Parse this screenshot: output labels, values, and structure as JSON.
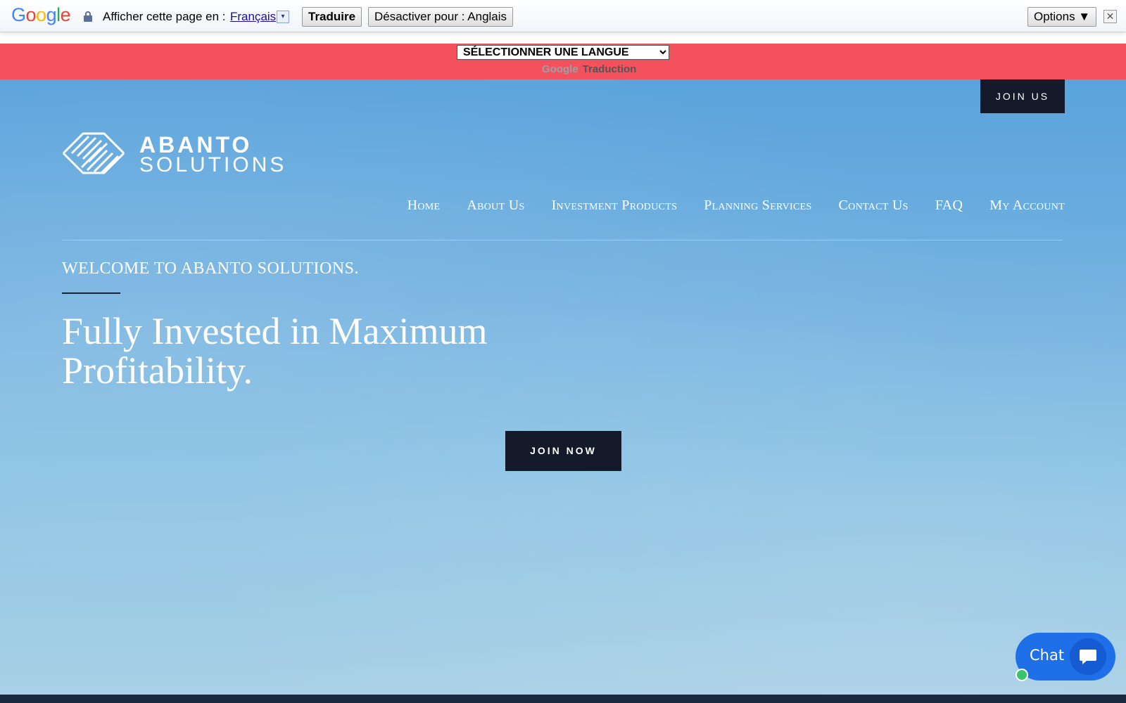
{
  "google_bar": {
    "logo": "Google",
    "prompt": "Afficher cette page en :",
    "language": "Français",
    "dropdown_glyph": "▾",
    "translate_button": "Traduire",
    "disable_button": "Désactiver pour : Anglais",
    "options_button": "Options ▼",
    "close_glyph": "✕"
  },
  "language_strip": {
    "select_value": "SÉLECTIONNER UNE LANGUE",
    "powered_logo": "Google",
    "powered_label": "Traduction",
    "background": "#f4515f"
  },
  "header": {
    "join_us": "JOIN US",
    "logo_line1": "ABANTO",
    "logo_line2": "SOLUTIONS"
  },
  "nav": {
    "items": [
      {
        "label": "Home"
      },
      {
        "label": "About Us"
      },
      {
        "label": "Investment Products"
      },
      {
        "label": "Planning Services"
      },
      {
        "label": "Contact Us"
      },
      {
        "label": "FAQ"
      },
      {
        "label": "My Account"
      }
    ]
  },
  "hero": {
    "welcome": "WELCOME TO ABANTO SOLUTIONS.",
    "headline": "Fully Invested in Maximum Profitability.",
    "cta": "JOIN NOW"
  },
  "chat": {
    "label": "Chat",
    "icon": "chat-bubble-icon",
    "accent": "#1e6fe8",
    "status_color": "#3cc46a"
  }
}
